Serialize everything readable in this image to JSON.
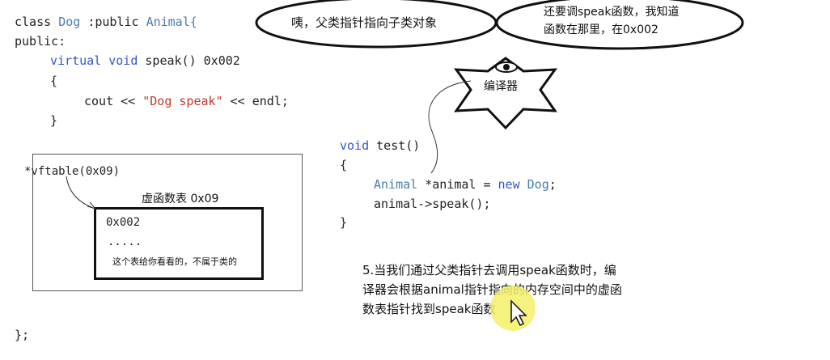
{
  "code_left": {
    "line1_kw": "class",
    "line1_name": "Dog",
    "line1_rest": ":public",
    "line1_base": "Animal{",
    "line2": "public:",
    "line3_kw1": "virtual",
    "line3_kw2": "void",
    "line3_rest": "speak() 0x002",
    "line4": "{",
    "line5_a": "cout << ",
    "line5_str": "\"Dog speak\"",
    "line5_b": " << endl;",
    "line6": "}",
    "closing": "};"
  },
  "vftable_box": {
    "pointer_label": "*vftable(0x09)",
    "table_title": "虚函数表 0x09",
    "entry_addr": "0x002",
    "entry_dots": ".....",
    "note": "这个表给你看看的，不属于类的"
  },
  "code_right": {
    "line1_kw": "void",
    "line1_rest": " test()",
    "line2": "{",
    "line3_type": "Animal",
    "line3_rest": " *animal = ",
    "line3_new": "new",
    "line3_cls": " Dog",
    "line3_end": ";",
    "line4": "animal->speak();",
    "line5": "}"
  },
  "bubbles": {
    "left": "咦，父类指针指向子类对象",
    "right_line1": "还要调speak函数，我知道",
    "right_line2": "函数在那里，在0x002"
  },
  "compiler": {
    "label": "编译器"
  },
  "explanation": {
    "line1": "5.当我们通过父类指针去调用speak函数时，编",
    "line2": "译器会根据animal指针指向的内存空间中的虚函",
    "line3": "数表指针找到speak函数"
  },
  "colors": {
    "keyword": "#3355cc",
    "string": "#c0392b",
    "type": "#4a7bb0",
    "cursor_highlight": "#f5f06a"
  }
}
